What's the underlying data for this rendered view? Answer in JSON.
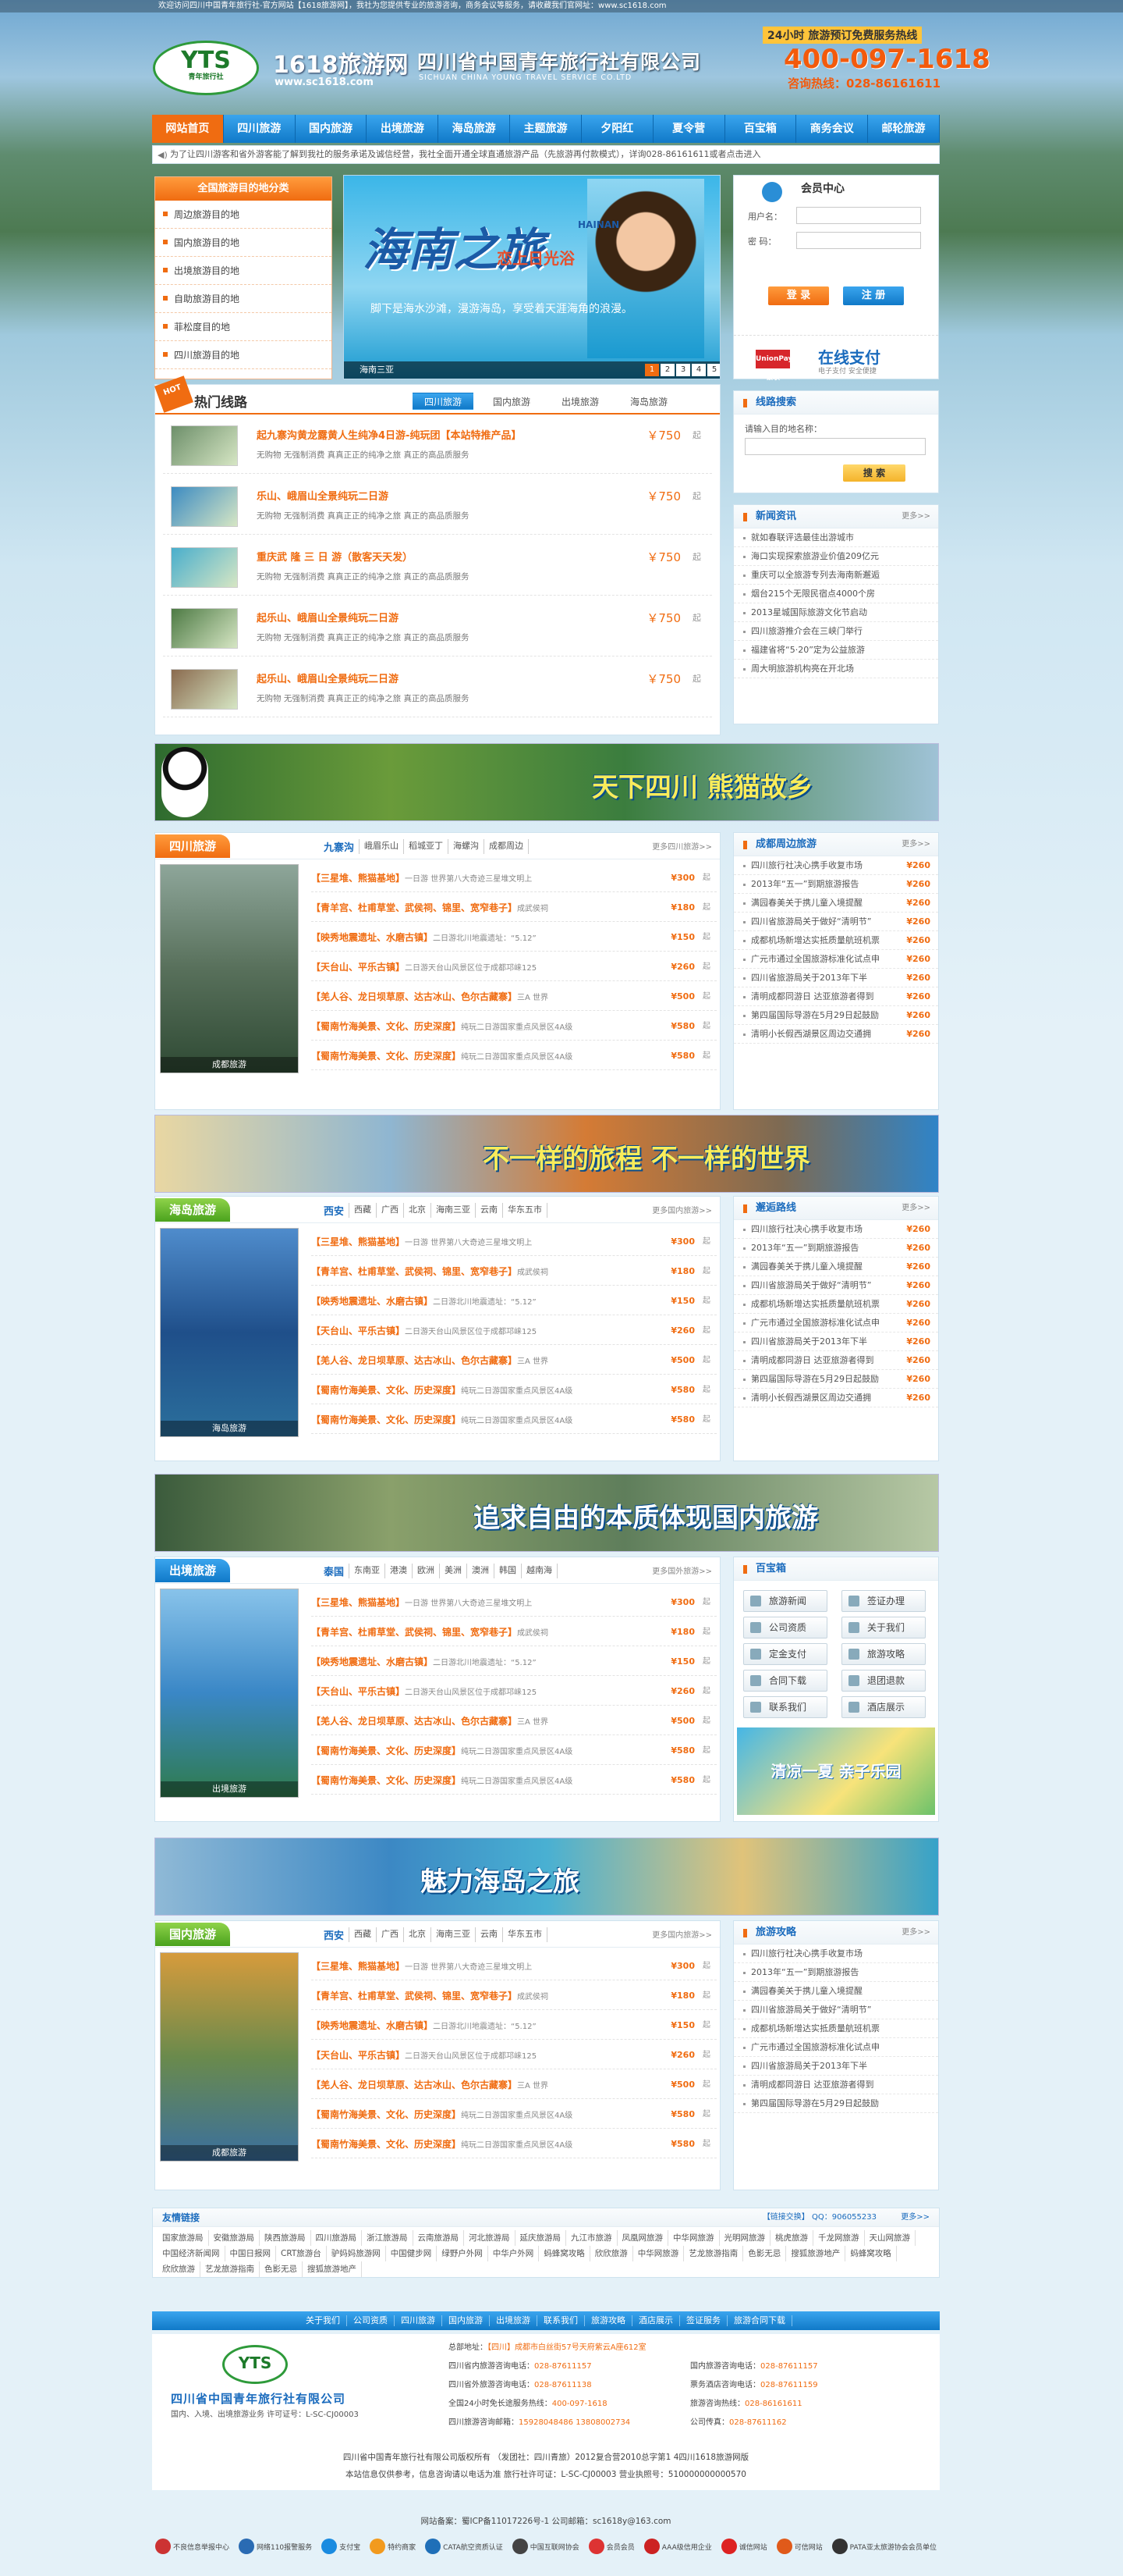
{
  "top_bar": "欢迎访问四川中国青年旅行社-官方网站【1618旅游网】，我社为您提供专业的旅游咨询，商务会议等服务，请收藏我们官网址：www.sc1618.com",
  "header": {
    "logo": "YTS",
    "logo_sub": "青年旅行社",
    "site_name": "1618旅游网",
    "site_url": "www.sc1618.com",
    "company_cn": "四川省中国青年旅行社有限公司",
    "company_en": "SICHUAN CHINA YOUNG TRAVEL SERVICE CO.LTD",
    "hotline_label": "24小时 旅游预订免费服务热线",
    "hotline": "400-097-1618",
    "consult": "咨询热线：028-86161611"
  },
  "nav": [
    "网站首页",
    "四川旅游",
    "国内旅游",
    "出境旅游",
    "海岛旅游",
    "主题旅游",
    "夕阳红",
    "夏令营",
    "百宝箱",
    "商务会议",
    "邮轮旅游"
  ],
  "notice": "为了让四川游客和省外游客能了解到我社的服务承诺及诚信经营，我社全面开通全球直通旅游产品（先旅游再付款模式），详询028-86161611或者点击进入",
  "categories": {
    "title": "全国旅游目的地分类",
    "items": [
      "周边旅游目的地",
      "国内旅游目的地",
      "出境旅游目的地",
      "自助旅游目的地",
      "菲松度目的地",
      "四川旅游目的地"
    ]
  },
  "slider": {
    "title": "海南之旅",
    "title_en": "HAINAN",
    "subtitle": "恋上日光浴",
    "text": "脚下是海水沙滩，漫游海岛，享受着天涯海角的浪漫。",
    "caption": "海南三亚",
    "nums": [
      "1",
      "2",
      "3",
      "4",
      "5"
    ]
  },
  "member": {
    "title": "会员中心",
    "user_label": "用户名：",
    "pass_label": "密  码：",
    "login": "登  录",
    "register": "注  册",
    "pay_title": "在线支付",
    "pay_logo": "UnionPay 银联",
    "pay_sub": "电子支付 安全便捷"
  },
  "hot": {
    "tag": "HOT",
    "title": "热门线路",
    "tabs": [
      "四川旅游",
      "国内旅游",
      "出境旅游",
      "海岛旅游"
    ],
    "items": [
      {
        "title": "起九寨沟黄龙露黄人生纯净4日游-纯玩团【本站特推产品】",
        "desc": "无购物  无强制消费  真真正正的纯净之旅  真正的高品质服务",
        "price": "￥750",
        "qi": "起"
      },
      {
        "title": "乐山、峨眉山全景纯玩二日游",
        "desc": "无购物  无强制消费  真真正正的纯净之旅  真正的高品质服务",
        "price": "￥750",
        "qi": "起"
      },
      {
        "title": "重庆武 隆 三 日 游（散客天天发）",
        "desc": "无购物  无强制消费  真真正正的纯净之旅  真正的高品质服务",
        "price": "￥750",
        "qi": "起"
      },
      {
        "title": "起乐山、峨眉山全景纯玩二日游",
        "desc": "无购物  无强制消费  真真正正的纯净之旅  真正的高品质服务",
        "price": "￥750",
        "qi": "起"
      },
      {
        "title": "起乐山、峨眉山全景纯玩二日游",
        "desc": "无购物  无强制消费  真真正正的纯净之旅  真正的高品质服务",
        "price": "￥750",
        "qi": "起"
      }
    ]
  },
  "search": {
    "title": "线路搜索",
    "label": "请输入目的地名称：",
    "button": "搜  索"
  },
  "news": {
    "title": "新闻资讯",
    "more": "更多>>",
    "items": [
      "就如春联评选最佳出游城市",
      "海口实现探索旅游业价值209亿元",
      "重庆可以全旅游专列去海南新邂逅",
      "烟台215个无限民宿点4000个房",
      "2013星城国际旅游文化节启动",
      "四川旅游推介会在三峡门举行",
      "福建省将“5·20”定为公益旅游",
      "周大明旅游机构亮在开北场"
    ]
  },
  "banners": [
    {
      "text": "天下四川   熊猫故乡"
    },
    {
      "text": "不一样的旅程 不一样的世界"
    },
    {
      "text": "追求自由的本质体现国内旅游"
    },
    {
      "text": "魅力海岛之旅"
    }
  ],
  "sections": [
    {
      "label": "四川旅游",
      "cities": [
        "九寨沟",
        "峨眉乐山",
        "稻城亚丁",
        "海螺沟",
        "成都周边"
      ],
      "more": "更多四川旅游>>",
      "caption": "成都旅游",
      "rows": [
        {
          "t": "【三星堆、熊猫基地】",
          "d": "一日游  世界第八大奇迹三星堆文明上",
          "p": "¥300",
          "q": "起"
        },
        {
          "t": "【青羊宫、杜甫草堂、武侯祠、锦里、宽窄巷子】",
          "d": "成武侯祠",
          "p": "¥180",
          "q": "起"
        },
        {
          "t": "【映秀地震遗址、水磨古镇】",
          "d": "二日游北川地震遗址：“5.12”",
          "p": "¥150",
          "q": "起"
        },
        {
          "t": "【天台山、平乐古镇】",
          "d": "二日游天台山风景区位于成都邛崃125",
          "p": "¥260",
          "q": "起"
        },
        {
          "t": "【羌人谷、龙日坝草原、达古冰山、色尔古藏寨】",
          "d": "三A 世界",
          "p": "¥500",
          "q": "起"
        },
        {
          "t": "【蜀南竹海美景、文化、历史深度】",
          "d": "纯玩二日游国家重点风景区4A级",
          "p": "¥580",
          "q": "起"
        },
        {
          "t": "【蜀南竹海美景、文化、历史深度】",
          "d": "纯玩二日游国家重点风景区4A级",
          "p": "¥580",
          "q": "起"
        }
      ],
      "side_title": "成都周边旅游",
      "side_more": "更多>>",
      "side": [
        {
          "t": "四川旅行社决心携手收复市场",
          "p": "¥260"
        },
        {
          "t": "2013年“五一”到期旅游报告",
          "p": "¥260"
        },
        {
          "t": "满园春美关于携儿童入境提醒",
          "p": "¥260"
        },
        {
          "t": "四川省旅游局关于做好“清明节”",
          "p": "¥260"
        },
        {
          "t": "成都机场新增达实抵质量航班机票",
          "p": "¥260"
        },
        {
          "t": "广元市通过全国旅游标准化试点申",
          "p": "¥260"
        },
        {
          "t": "四川省旅游局关于2013年下半",
          "p": "¥260"
        },
        {
          "t": "清明成都同游日  达亚旅游者得到",
          "p": "¥260"
        },
        {
          "t": "第四届国际导游在5月29日起鼓励",
          "p": "¥260"
        },
        {
          "t": "清明小长假西湖景区周边交通拥",
          "p": "¥260"
        }
      ]
    },
    {
      "label": "海岛旅游",
      "cities": [
        "西安",
        "西藏",
        "广西",
        "北京",
        "海南三亚",
        "云南",
        "华东五市"
      ],
      "more": "更多国内旅游>>",
      "caption": "海岛旅游",
      "rows": [
        {
          "t": "【三星堆、熊猫基地】",
          "d": "一日游  世界第八大奇迹三星堆文明上",
          "p": "¥300",
          "q": "起"
        },
        {
          "t": "【青羊宫、杜甫草堂、武侯祠、锦里、宽窄巷子】",
          "d": "成武侯祠",
          "p": "¥180",
          "q": "起"
        },
        {
          "t": "【映秀地震遗址、水磨古镇】",
          "d": "二日游北川地震遗址：“5.12”",
          "p": "¥150",
          "q": "起"
        },
        {
          "t": "【天台山、平乐古镇】",
          "d": "二日游天台山风景区位于成都邛崃125",
          "p": "¥260",
          "q": "起"
        },
        {
          "t": "【羌人谷、龙日坝草原、达古冰山、色尔古藏寨】",
          "d": "三A 世界",
          "p": "¥500",
          "q": "起"
        },
        {
          "t": "【蜀南竹海美景、文化、历史深度】",
          "d": "纯玩二日游国家重点风景区4A级",
          "p": "¥580",
          "q": "起"
        },
        {
          "t": "【蜀南竹海美景、文化、历史深度】",
          "d": "纯玩二日游国家重点风景区4A级",
          "p": "¥580",
          "q": "起"
        }
      ],
      "side_title": "邂逅路线",
      "side_more": "更多>>",
      "side": [
        {
          "t": "四川旅行社决心携手收复市场",
          "p": "¥260"
        },
        {
          "t": "2013年“五一”到期旅游报告",
          "p": "¥260"
        },
        {
          "t": "满园春美关于携儿童入境提醒",
          "p": "¥260"
        },
        {
          "t": "四川省旅游局关于做好“清明节”",
          "p": "¥260"
        },
        {
          "t": "成都机场新增达实抵质量航班机票",
          "p": "¥260"
        },
        {
          "t": "广元市通过全国旅游标准化试点申",
          "p": "¥260"
        },
        {
          "t": "四川省旅游局关于2013年下半",
          "p": "¥260"
        },
        {
          "t": "清明成都同游日  达亚旅游者得到",
          "p": "¥260"
        },
        {
          "t": "第四届国际导游在5月29日起鼓励",
          "p": "¥260"
        },
        {
          "t": "清明小长假西湖景区周边交通拥",
          "p": "¥260"
        }
      ]
    },
    {
      "label": "出境旅游",
      "cities": [
        "泰国",
        "东南亚",
        "港澳",
        "欧洲",
        "美洲",
        "澳洲",
        "韩国",
        "越南海"
      ],
      "more": "更多国外旅游>>",
      "caption": "出境旅游",
      "rows": [
        {
          "t": "【三星堆、熊猫基地】",
          "d": "一日游  世界第八大奇迹三星堆文明上",
          "p": "¥300",
          "q": "起"
        },
        {
          "t": "【青羊宫、杜甫草堂、武侯祠、锦里、宽窄巷子】",
          "d": "成武侯祠",
          "p": "¥180",
          "q": "起"
        },
        {
          "t": "【映秀地震遗址、水磨古镇】",
          "d": "二日游北川地震遗址：“5.12”",
          "p": "¥150",
          "q": "起"
        },
        {
          "t": "【天台山、平乐古镇】",
          "d": "二日游天台山风景区位于成都邛崃125",
          "p": "¥260",
          "q": "起"
        },
        {
          "t": "【羌人谷、龙日坝草原、达古冰山、色尔古藏寨】",
          "d": "三A 世界",
          "p": "¥500",
          "q": "起"
        },
        {
          "t": "【蜀南竹海美景、文化、历史深度】",
          "d": "纯玩二日游国家重点风景区4A级",
          "p": "¥580",
          "q": "起"
        },
        {
          "t": "【蜀南竹海美景、文化、历史深度】",
          "d": "纯玩二日游国家重点风景区4A级",
          "p": "¥580",
          "q": "起"
        }
      ],
      "side_title": "百宝箱",
      "toolbox": [
        "旅游新闻",
        "签证办理",
        "公司资质",
        "关于我们",
        "定金支付",
        "旅游攻略",
        "合同下载",
        "退团退款",
        "联系我们",
        "酒店展示"
      ],
      "promo": "清凉一夏 亲子乐园"
    },
    {
      "label": "国内旅游",
      "cities": [
        "西安",
        "西藏",
        "广西",
        "北京",
        "海南三亚",
        "云南",
        "华东五市"
      ],
      "more": "更多国内旅游>>",
      "caption": "成都旅游",
      "rows": [
        {
          "t": "【三星堆、熊猫基地】",
          "d": "一日游  世界第八大奇迹三星堆文明上",
          "p": "¥300",
          "q": "起"
        },
        {
          "t": "【青羊宫、杜甫草堂、武侯祠、锦里、宽窄巷子】",
          "d": "成武侯祠",
          "p": "¥180",
          "q": "起"
        },
        {
          "t": "【映秀地震遗址、水磨古镇】",
          "d": "二日游北川地震遗址：“5.12”",
          "p": "¥150",
          "q": "起"
        },
        {
          "t": "【天台山、平乐古镇】",
          "d": "二日游天台山风景区位于成都邛崃125",
          "p": "¥260",
          "q": "起"
        },
        {
          "t": "【羌人谷、龙日坝草原、达古冰山、色尔古藏寨】",
          "d": "三A 世界",
          "p": "¥500",
          "q": "起"
        },
        {
          "t": "【蜀南竹海美景、文化、历史深度】",
          "d": "纯玩二日游国家重点风景区4A级",
          "p": "¥580",
          "q": "起"
        },
        {
          "t": "【蜀南竹海美景、文化、历史深度】",
          "d": "纯玩二日游国家重点风景区4A级",
          "p": "¥580",
          "q": "起"
        }
      ],
      "side_title": "旅游攻略",
      "side_more": "更多>>",
      "side": [
        {
          "t": "四川旅行社决心携手收复市场",
          "p": ""
        },
        {
          "t": "2013年“五一”到期旅游报告",
          "p": ""
        },
        {
          "t": "满园春美关于携儿童入境提醒",
          "p": ""
        },
        {
          "t": "四川省旅游局关于做好“清明节”",
          "p": ""
        },
        {
          "t": "成都机场新增达实抵质量航班机票",
          "p": ""
        },
        {
          "t": "广元市通过全国旅游标准化试点申",
          "p": ""
        },
        {
          "t": "四川省旅游局关于2013年下半",
          "p": ""
        },
        {
          "t": "清明成都同游日  达亚旅游者得到",
          "p": ""
        },
        {
          "t": "第四届国际导游在5月29日起鼓励",
          "p": ""
        }
      ]
    }
  ],
  "links": {
    "title": "友情链接",
    "apply": "【链接交换】 QQ：906055233",
    "more": "更多>>",
    "items": [
      "国家旅游局",
      "安徽旅游局",
      "陕西旅游局",
      "四川旅游局",
      "浙江旅游局",
      "云南旅游局",
      "河北旅游局",
      "延庆旅游局",
      "九江市旅游",
      "凤凰网旅游",
      "中华网旅游",
      "光明网旅游",
      "桃虎旅游",
      "千龙网旅游",
      "天山网旅游",
      "中国经济新闻网",
      "中国日报网",
      "CRT旅游台",
      "驴妈妈旅游网",
      "中国健步网",
      "绿野户外网",
      "中华户外网",
      "蚂蜂窝攻略",
      "欣欣旅游",
      "中华网旅游",
      "艺龙旅游指南",
      "色影无忌",
      "搜狐旅游地产",
      "蚂蜂窝攻略",
      "欣欣旅游",
      "艺龙旅游指南",
      "色影无忌",
      "搜狐旅游地产"
    ]
  },
  "footer_nav": [
    "关于我们",
    "公司资质",
    "四川旅游",
    "国内旅游",
    "出境旅游",
    "联系我们",
    "旅游攻略",
    "酒店展示",
    "签证服务",
    "旅游合同下载"
  ],
  "footer": {
    "logo": "YTS",
    "company": "四川省中国青年旅行社有限公司",
    "sub": "国内、入境、出境旅游业务 许可证号：L-SC-CJ00003",
    "lines_left": [
      {
        "k": "总部地址：",
        "v": "【四川】成都市白丝街57号天府紫云A座612室"
      },
      {
        "k": "四川省内旅游咨询电话：",
        "v": "028-87611157"
      },
      {
        "k": "四川省外旅游咨询电话：",
        "v": "028-87611138"
      },
      {
        "k": "全国24小时免长途服务热线：",
        "v": "400-097-1618"
      },
      {
        "k": "四川旅游咨询邮箱：",
        "v": "15928048486",
        "v2": "13808002734"
      }
    ],
    "lines_right": [
      {
        "k": "国内旅游咨询电话：",
        "v": "028-87611157"
      },
      {
        "k": "票务酒店咨询电话：",
        "v": "028-87611159"
      },
      {
        "k": "旅游咨询热线：",
        "v": "028-86161611"
      },
      {
        "k": "公司传真：",
        "v": "028-87611162"
      }
    ],
    "copy1": "四川省中国青年旅行社有限公司版权所有 （发团社：四川青旅）2012复合营2010总字第1  4四川1618旅游网版",
    "copy2": "本站信息仅供参考，信息咨询请以电话为准     旅行社许可证：L-SC-CJ00003   营业执照号：510000000000570",
    "copy3": "网站备案：蜀ICP备11017226号-1     公司邮箱：sc1618y@163.com",
    "badges": [
      "不良信息举报中心",
      "网络110报警服务",
      "支付宝",
      "特约商家",
      "CATA航空资质认证",
      "中国互联网协会",
      "会员会员",
      "AAA级信用企业",
      "诚信网站",
      "可信网站",
      "PATA亚太旅游协会会员单位"
    ]
  }
}
